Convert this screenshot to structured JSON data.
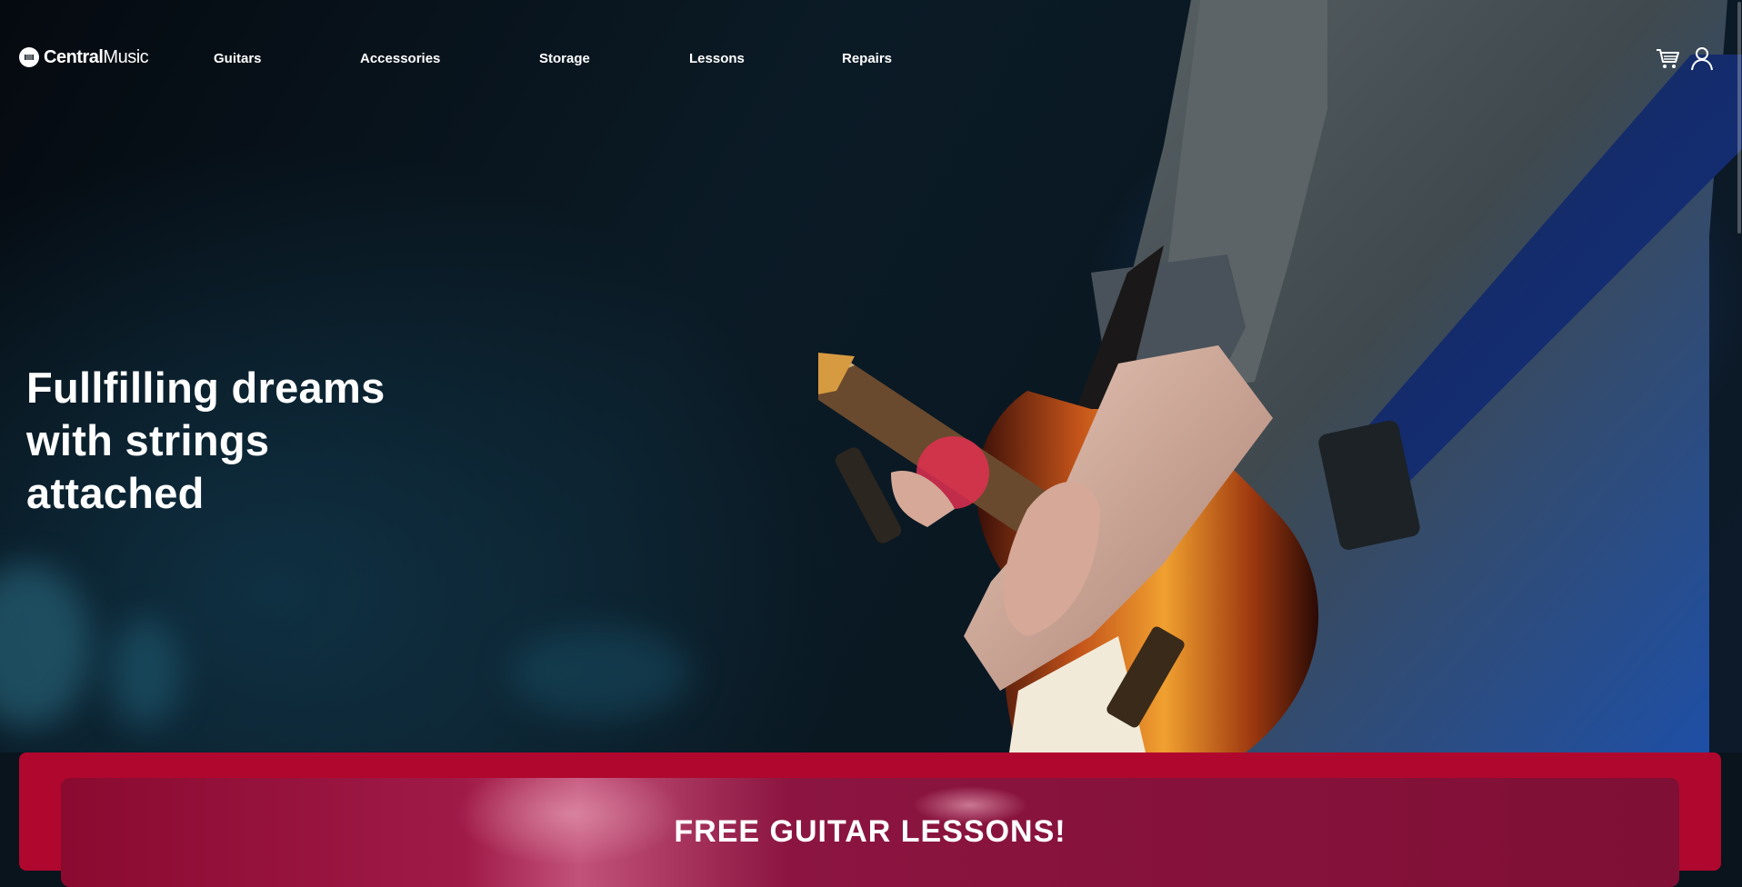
{
  "brand": {
    "name_bold": "Central",
    "name_light": "Music"
  },
  "nav": {
    "links": [
      "Guitars",
      "Accessories",
      "Storage",
      "Lessons",
      "Repairs"
    ],
    "cart_icon": "cart-icon",
    "account_icon": "user-icon"
  },
  "hero": {
    "headline_lines": [
      "Fullfilling dreams",
      "with strings",
      "attached"
    ]
  },
  "promo": {
    "title": "FREE GUITAR LESSONS!"
  },
  "colors": {
    "promo_red": "#b0072e",
    "text": "#ffffff",
    "hero_dark": "#0a141c"
  }
}
